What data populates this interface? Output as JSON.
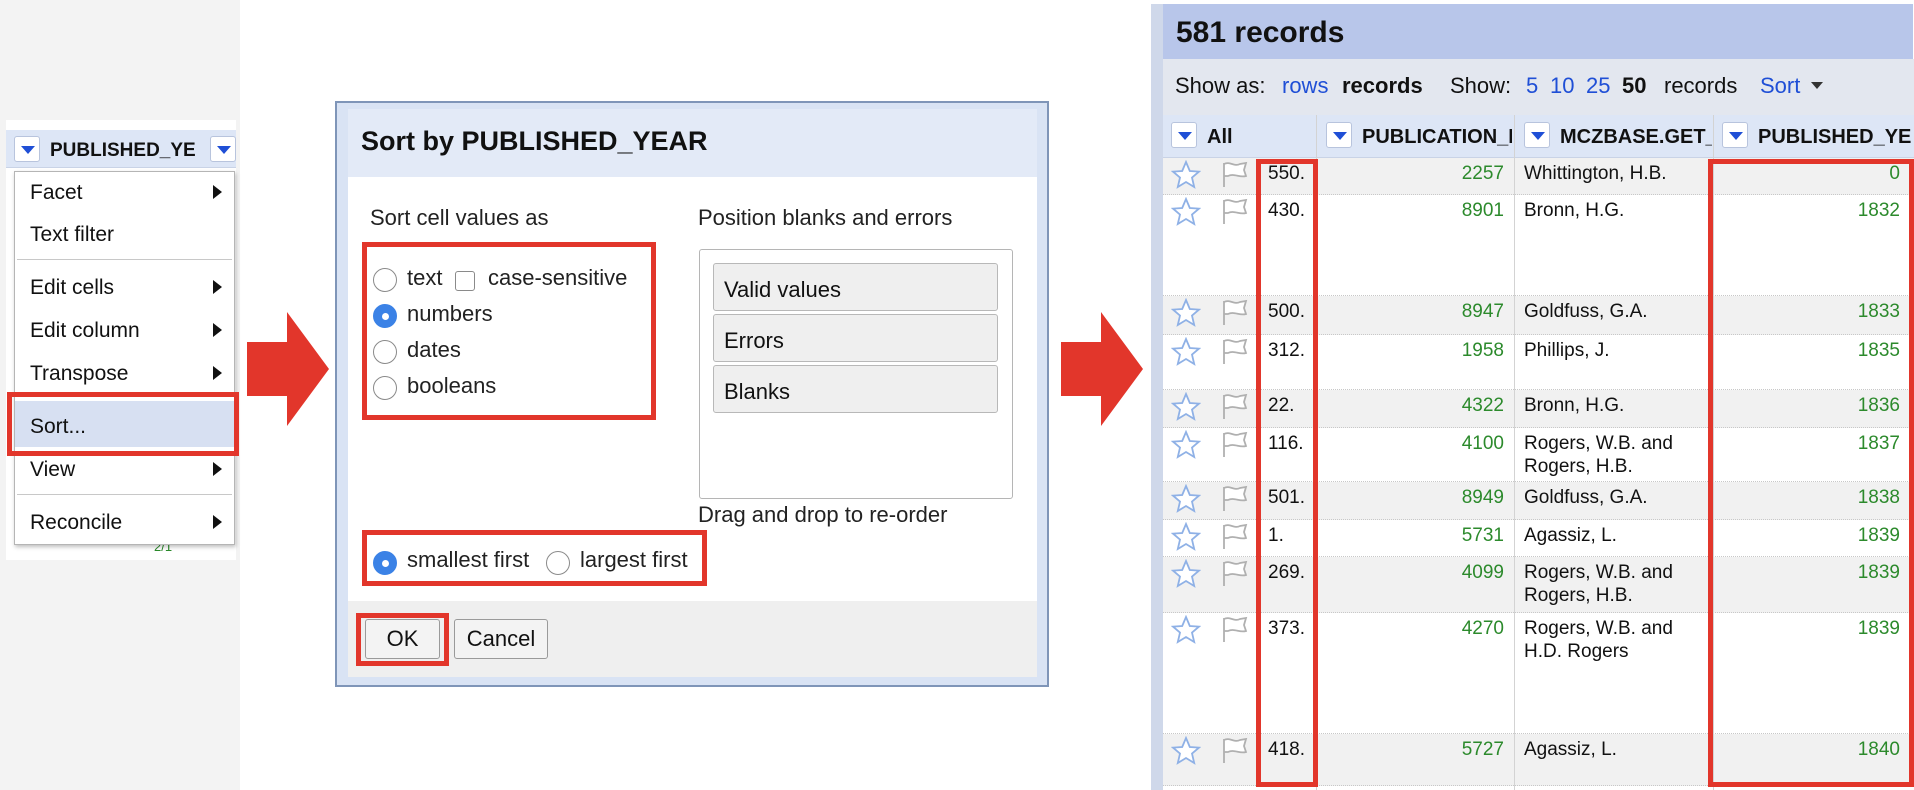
{
  "column_menu": {
    "column_name": "PUBLISHED_YE",
    "items": [
      {
        "label": "Facet",
        "has_submenu": true
      },
      {
        "label": "Text filter",
        "has_submenu": false
      },
      {
        "label": "Edit cells",
        "has_submenu": true
      },
      {
        "label": "Edit column",
        "has_submenu": true
      },
      {
        "label": "Transpose",
        "has_submenu": true
      },
      {
        "label": "Sort...",
        "has_submenu": false,
        "highlighted": true
      },
      {
        "label": "View",
        "has_submenu": true
      },
      {
        "label": "Reconcile",
        "has_submenu": true
      }
    ],
    "cell_fragment": "2/1"
  },
  "sort_dialog": {
    "title": "Sort by PUBLISHED_YEAR",
    "sort_as_label": "Sort cell values as",
    "sort_options": [
      {
        "label": "text",
        "selected": false
      },
      {
        "label": "numbers",
        "selected": true
      },
      {
        "label": "dates",
        "selected": false
      },
      {
        "label": "booleans",
        "selected": false
      }
    ],
    "case_sensitive_label": "case-sensitive",
    "case_sensitive_checked": false,
    "position_label": "Position blanks and errors",
    "position_items": [
      "Valid values",
      "Errors",
      "Blanks"
    ],
    "drag_hint": "Drag and drop to re-order",
    "order_options": [
      {
        "label": "smallest first",
        "selected": true
      },
      {
        "label": "largest first",
        "selected": false
      }
    ],
    "ok_label": "OK",
    "cancel_label": "Cancel"
  },
  "records_view": {
    "title": "581 records",
    "show_as_label": "Show as:",
    "show_as_rows": "rows",
    "show_as_records": "records",
    "show_label": "Show:",
    "page_sizes": [
      "5",
      "10",
      "25",
      "50"
    ],
    "page_size_selected": "50",
    "show_suffix": "records",
    "sort_menu": "Sort",
    "columns": [
      "All",
      "PUBLICATION_I",
      "MCZBASE.GET_",
      "PUBLISHED_YE"
    ],
    "rows": [
      {
        "index": "550.",
        "publication_id": "2257",
        "author": [
          "Whittington, H.B."
        ],
        "year": "0"
      },
      {
        "index": "430.",
        "publication_id": "8901",
        "author": [
          "Bronn, H.G."
        ],
        "year": "1832"
      },
      {
        "index": "500.",
        "publication_id": "8947",
        "author": [
          "Goldfuss, G.A."
        ],
        "year": "1833"
      },
      {
        "index": "312.",
        "publication_id": "1958",
        "author": [
          "Phillips, J."
        ],
        "year": "1835"
      },
      {
        "index": "22.",
        "publication_id": "4322",
        "author": [
          "Bronn, H.G."
        ],
        "year": "1836"
      },
      {
        "index": "116.",
        "publication_id": "4100",
        "author": [
          "Rogers, W.B. and",
          "Rogers, H.B."
        ],
        "year": "1837"
      },
      {
        "index": "501.",
        "publication_id": "8949",
        "author": [
          "Goldfuss, G.A."
        ],
        "year": "1838"
      },
      {
        "index": "1.",
        "publication_id": "5731",
        "author": [
          "Agassiz, L."
        ],
        "year": "1839"
      },
      {
        "index": "269.",
        "publication_id": "4099",
        "author": [
          "Rogers, W.B. and",
          "Rogers, H.B."
        ],
        "year": "1839"
      },
      {
        "index": "373.",
        "publication_id": "4270",
        "author": [
          "Rogers, W.B. and",
          "H.D. Rogers"
        ],
        "year": "1839"
      },
      {
        "index": "418.",
        "publication_id": "5727",
        "author": [
          "Agassiz, L."
        ],
        "year": "1840"
      }
    ]
  },
  "colors": {
    "highlight_red": "#e2362b",
    "link_blue": "#1f4fd6",
    "number_green": "#2c8a2c",
    "header_blue": "#dde6f6"
  }
}
